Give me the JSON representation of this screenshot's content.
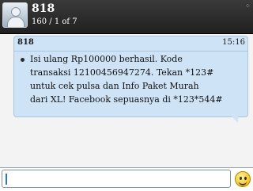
{
  "header": {
    "contact_name": "818",
    "message_counter": "160 / 1 of 7",
    "corner_icon": "blackberry-icon"
  },
  "thread": {
    "messages": [
      {
        "sender": "818",
        "time": "15:16",
        "lines": [
          "Isi ulang Rp100000 berhasil. Kode",
          "transaksi 12100456947274. Tekan *123#",
          "untuk cek pulsa dan Info Paket Murah",
          "dari XL! Facebook sepuasnya di *123*544#"
        ]
      }
    ]
  },
  "composer": {
    "value": "",
    "emoticon_icon": "smiley-icon"
  },
  "colors": {
    "header_bg": "#2a2a2a",
    "bubble_bg": "#cfe3f6",
    "bubble_border": "#a9c5de",
    "page_bg": "#f3f3f3",
    "caret": "#2a78c5"
  }
}
